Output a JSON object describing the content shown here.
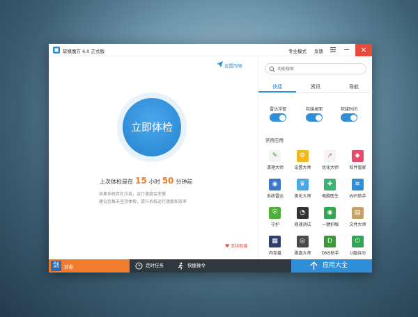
{
  "titlebar": {
    "title": "软媒魔方 6.0 正式版",
    "pro_mode": "专业模式",
    "feedback": "反馈",
    "close_glyph": "×"
  },
  "main": {
    "setup_guide": "设置向导",
    "check_button": "立即体检",
    "last_check_prefix": "上次体检是在",
    "hours": "15",
    "hours_unit": "小时",
    "minutes": "50",
    "minutes_suffix": "分钟前",
    "hint_line1": "如果系统存在垃圾，运行速度会变慢",
    "hint_line2": "建议您每天坚持体检，提升系统运行速度和效率",
    "support": "支持软媒"
  },
  "sidebar": {
    "search_placeholder": "功能搜索",
    "tabs": [
      "快捷",
      "资讯",
      "导航"
    ],
    "toggles": [
      {
        "label": "雷达浮窗",
        "on": true
      },
      {
        "label": "软媒桌面",
        "on": true
      },
      {
        "label": "软媒时间",
        "on": true
      }
    ],
    "section_title": "常用应用",
    "apps": [
      {
        "label": "清理大师",
        "icon": "broom-icon",
        "color": "#f4f4f4"
      },
      {
        "label": "设置大师",
        "icon": "gear-icon",
        "color": "#f2b820"
      },
      {
        "label": "优化大师",
        "icon": "rocket-icon",
        "color": "#f5f5f5"
      },
      {
        "label": "软件管家",
        "icon": "diamond-icon",
        "color": "#e84b6e"
      },
      {
        "label": "系统雷达",
        "icon": "radar-icon",
        "color": "#3c78c8"
      },
      {
        "label": "美化大师",
        "icon": "tshirt-icon",
        "color": "#4aa8e6"
      },
      {
        "label": "电脑医生",
        "icon": "medkit-icon",
        "color": "#3cb371"
      },
      {
        "label": "WiFi助手",
        "icon": "wifi-icon",
        "color": "#2f8ed8"
      },
      {
        "label": "守护",
        "icon": "shield-icon",
        "color": "#4fae3c"
      },
      {
        "label": "网速测试",
        "icon": "gauge-icon",
        "color": "#333333"
      },
      {
        "label": "一键护眼",
        "icon": "eye-icon",
        "color": "#2fa84f"
      },
      {
        "label": "文件大师",
        "icon": "folder-icon",
        "color": "#c8a060"
      },
      {
        "label": "内存盘",
        "icon": "ram-icon",
        "color": "#2e3f6e"
      },
      {
        "label": "磁盘大师",
        "icon": "disk-icon",
        "color": "#4a4a4a"
      },
      {
        "label": "DNS助手",
        "icon": "dns-icon",
        "color": "#3a9a3a"
      },
      {
        "label": "U盘启动",
        "icon": "usb-icon",
        "color": "#2fa84f"
      }
    ]
  },
  "bottombar": {
    "user_logo": "剑",
    "user_name": "剑春",
    "scheduled_tasks": "定时任务",
    "quick_shutdown": "快捷操令",
    "app_center": "应用大全"
  }
}
